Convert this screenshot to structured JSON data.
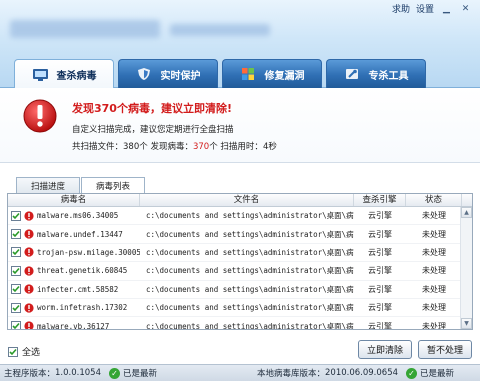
{
  "header": {
    "links": [
      "求助",
      "设置"
    ]
  },
  "tabs": [
    {
      "label": "查杀病毒",
      "icon": "scan-monitor-icon",
      "active": true
    },
    {
      "label": "实时保护",
      "icon": "shield-icon",
      "active": false
    },
    {
      "label": "修复漏洞",
      "icon": "windows-icon",
      "active": false
    },
    {
      "label": "专杀工具",
      "icon": "tools-icon",
      "active": false
    }
  ],
  "alert": {
    "title": "发现370个病毒，建议立即清除!",
    "subtitle": "自定义扫描完成，建议您定期进行全盘扫描",
    "stats_files_label": "共扫描文件：",
    "stats_files_value": "380个",
    "stats_virus_label": "发现病毒：",
    "stats_virus_value": "370",
    "stats_virus_unit": "个",
    "stats_time_label": "扫描用时：",
    "stats_time_value": "4秒"
  },
  "subtabs": [
    {
      "label": "扫描进度",
      "active": false
    },
    {
      "label": "病毒列表",
      "active": true
    }
  ],
  "table": {
    "headers": [
      "病毒名",
      "文件名",
      "查杀引擎",
      "状态"
    ],
    "rows": [
      {
        "name": "malware.ms06.34005",
        "file": "c:\\documents and settings\\administrator\\桌面\\病...",
        "engine": "云引擎",
        "status": "未处理"
      },
      {
        "name": "malware.undef.13447",
        "file": "c:\\documents and settings\\administrator\\桌面\\病...",
        "engine": "云引擎",
        "status": "未处理"
      },
      {
        "name": "trojan-psw.milage.30005",
        "file": "c:\\documents and settings\\administrator\\桌面\\病...",
        "engine": "云引擎",
        "status": "未处理"
      },
      {
        "name": "threat.genetik.60845",
        "file": "c:\\documents and settings\\administrator\\桌面\\病...",
        "engine": "云引擎",
        "status": "未处理"
      },
      {
        "name": "infecter.cmt.58582",
        "file": "c:\\documents and settings\\administrator\\桌面\\病...",
        "engine": "云引擎",
        "status": "未处理"
      },
      {
        "name": "worm.infetrash.17302",
        "file": "c:\\documents and settings\\administrator\\桌面\\病...",
        "engine": "云引擎",
        "status": "未处理"
      },
      {
        "name": "malware.vb.36127",
        "file": "c:\\documents and settings\\administrator\\桌面\\病...",
        "engine": "云引擎",
        "status": "未处理"
      }
    ]
  },
  "controls": {
    "select_all": "全选",
    "clean_now": "立即清除",
    "ignore": "暂不处理"
  },
  "statusbar": {
    "program_label": "主程序版本：",
    "program_version": "1.0.0.1054",
    "program_state": "已是最新",
    "db_label": "本地病毒库版本：",
    "db_version": "2010.06.09.0654",
    "db_state": "已是最新"
  },
  "colors": {
    "accent_blue": "#2f6fb4",
    "alert_red": "#d21c1c",
    "ok_green": "#35a535"
  }
}
